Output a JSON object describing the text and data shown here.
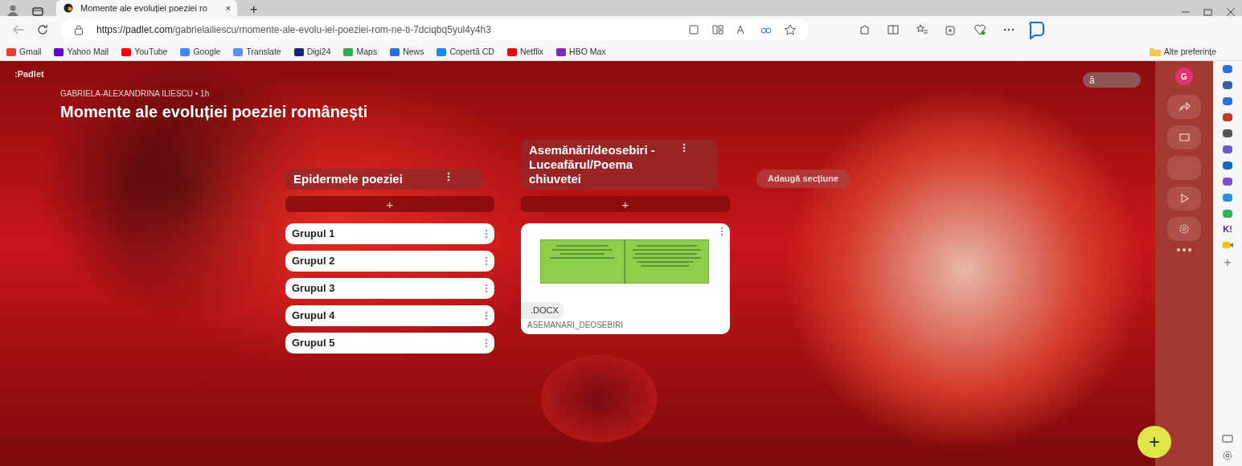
{
  "browser": {
    "tab": {
      "title": "Momente ale evoluției poeziei ro",
      "selected": true
    },
    "tab_close": "×",
    "new_tab": "+",
    "url_host": "https://padlet.com",
    "url_path": "/gabrielailiescu/momente-ale-evolu-iei-poeziei-rom-ne-ti-7dciqbq5yul4y4h3",
    "bookmarks": [
      {
        "label": "Gmail",
        "color": "#ea4335"
      },
      {
        "label": "Yahoo Mail",
        "color": "#6001d2"
      },
      {
        "label": "YouTube",
        "color": "#ff0000"
      },
      {
        "label": "Google",
        "color": "#4285f4"
      },
      {
        "label": "Translate",
        "color": "#5b8def"
      },
      {
        "label": "Digi24",
        "color": "#1a237e"
      },
      {
        "label": "Maps",
        "color": "#34a853"
      },
      {
        "label": "News",
        "color": "#2a6fdb"
      },
      {
        "label": "Copertă CD",
        "color": "#1e88e5"
      },
      {
        "label": "Netflix",
        "color": "#e50914"
      },
      {
        "label": "HBO Max",
        "color": "#7b2cbf"
      }
    ],
    "other_favorites": "Alte preferințe"
  },
  "padlet": {
    "logo": ":Padlet",
    "author": "GABRIELA-ALEXANDRINA ILIESCU • 1h",
    "title": "Momente ale evoluției poeziei românești",
    "sections": [
      {
        "title": "Epidermele poeziei",
        "add": "+",
        "posts": [
          {
            "kind": "text",
            "title": "Grupul 1"
          },
          {
            "kind": "text",
            "title": "Grupul 2"
          },
          {
            "kind": "text",
            "title": "Grupul 3"
          },
          {
            "kind": "text",
            "title": "Grupul 4"
          },
          {
            "kind": "text",
            "title": "Grupul 5"
          }
        ]
      },
      {
        "title": "Asemănări/deosebiri - Luceafărul/Poema chiuvetei",
        "add": "+",
        "posts": [
          {
            "kind": "attachment",
            "file_type": ".DOCX",
            "file_name": "ASEMANARI_DEOSEBIRI"
          }
        ]
      }
    ],
    "add_section": "Adaugă secțiune",
    "search": "ă",
    "avatar": "G",
    "fab": "+"
  },
  "edge_sidebar": {
    "app_label": "K!",
    "add": "+"
  }
}
